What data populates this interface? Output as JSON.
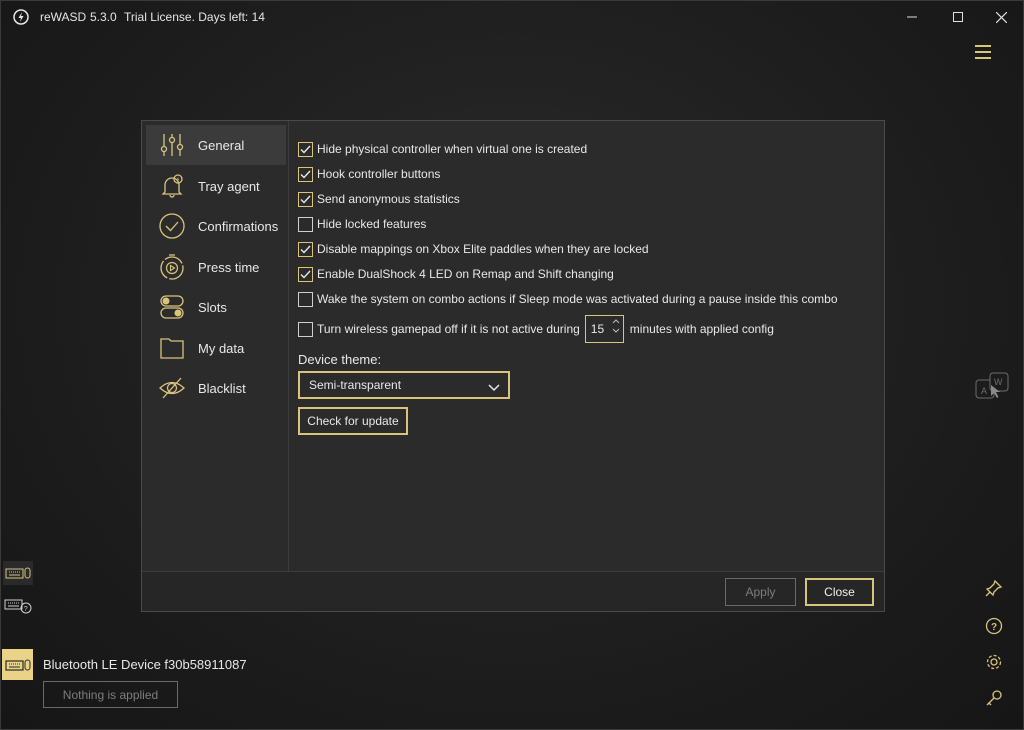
{
  "window": {
    "app_name": "reWASD",
    "version": "5.3.0",
    "license": "Trial License. Days left: 14"
  },
  "colors": {
    "accent": "#d9c47c",
    "device_badge": "#e9d387",
    "background": "#1c1c1c",
    "dialog": "#2b2b2b"
  },
  "nav": {
    "items": [
      {
        "label": "General",
        "icon": "sliders-icon"
      },
      {
        "label": "Tray agent",
        "icon": "bell-icon"
      },
      {
        "label": "Confirmations",
        "icon": "check-circle-icon"
      },
      {
        "label": "Press time",
        "icon": "timer-icon"
      },
      {
        "label": "Slots",
        "icon": "toggle-icon"
      },
      {
        "label": "My data",
        "icon": "folder-icon"
      },
      {
        "label": "Blacklist",
        "icon": "eye-off-icon"
      }
    ],
    "active": "General"
  },
  "options": [
    {
      "label": "Hide physical controller when virtual one is created",
      "checked": true
    },
    {
      "label": "Hook controller buttons",
      "checked": true
    },
    {
      "label": "Send anonymous statistics",
      "checked": true
    },
    {
      "label": "Hide locked features",
      "checked": false
    },
    {
      "label": "Disable mappings on Xbox Elite paddles when they are locked",
      "checked": true
    },
    {
      "label": "Enable DualShock 4 LED on Remap and Shift changing",
      "checked": true
    },
    {
      "label": "Wake the system on combo actions if Sleep mode was activated during a pause inside this combo",
      "checked": false
    }
  ],
  "wireless": {
    "label_before": "Turn wireless gamepad off if it is not active during",
    "minutes": "15",
    "label_after": "minutes with applied config",
    "checked": false
  },
  "theme": {
    "label": "Device theme:",
    "selected": "Semi-transparent"
  },
  "buttons": {
    "check_update": "Check for update",
    "apply": "Apply",
    "close": "Close"
  },
  "device": {
    "name": "Bluetooth LE Device f30b58911087",
    "status": "Nothing is applied"
  }
}
